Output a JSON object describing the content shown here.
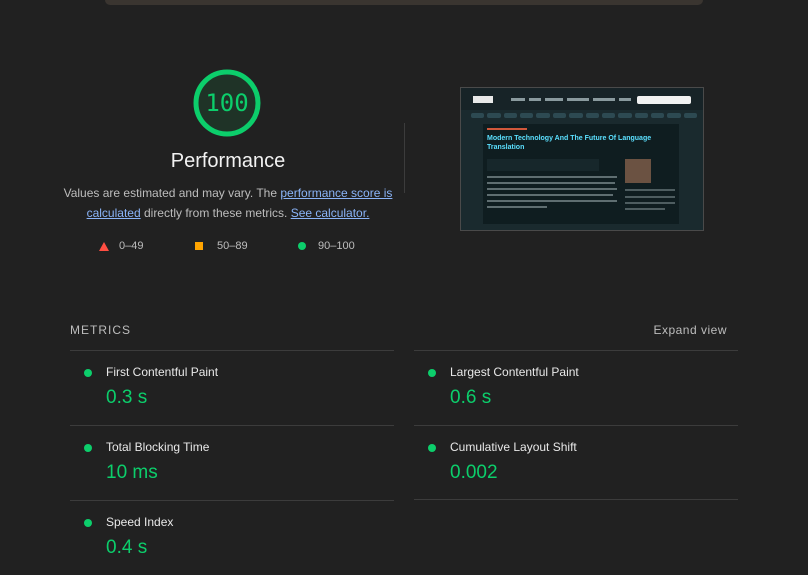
{
  "performance": {
    "score": "100",
    "score_color": "#0cce6b",
    "title": "Performance",
    "desc_prefix": "Values are estimated and may vary. The ",
    "link_score": "performance score is calculated",
    "desc_middle": " directly from these metrics. ",
    "link_calculator": "See calculator."
  },
  "legend": [
    {
      "shape": "triangle-icon",
      "label": "0–49",
      "color": "#ff4e42"
    },
    {
      "shape": "square-icon",
      "label": "50–89",
      "color": "#ffa400"
    },
    {
      "shape": "circle-icon",
      "label": "90–100",
      "color": "#0cce6b"
    }
  ],
  "screenshot": {
    "headline": "Modern Technology And The Future Of Language Translation"
  },
  "metrics": {
    "heading": "METRICS",
    "expand_label": "Expand view",
    "items": [
      {
        "name": "First Contentful Paint",
        "value": "0.3 s"
      },
      {
        "name": "Largest Contentful Paint",
        "value": "0.6 s"
      },
      {
        "name": "Total Blocking Time",
        "value": "10 ms"
      },
      {
        "name": "Cumulative Layout Shift",
        "value": "0.002"
      },
      {
        "name": "Speed Index",
        "value": "0.4 s"
      }
    ]
  }
}
